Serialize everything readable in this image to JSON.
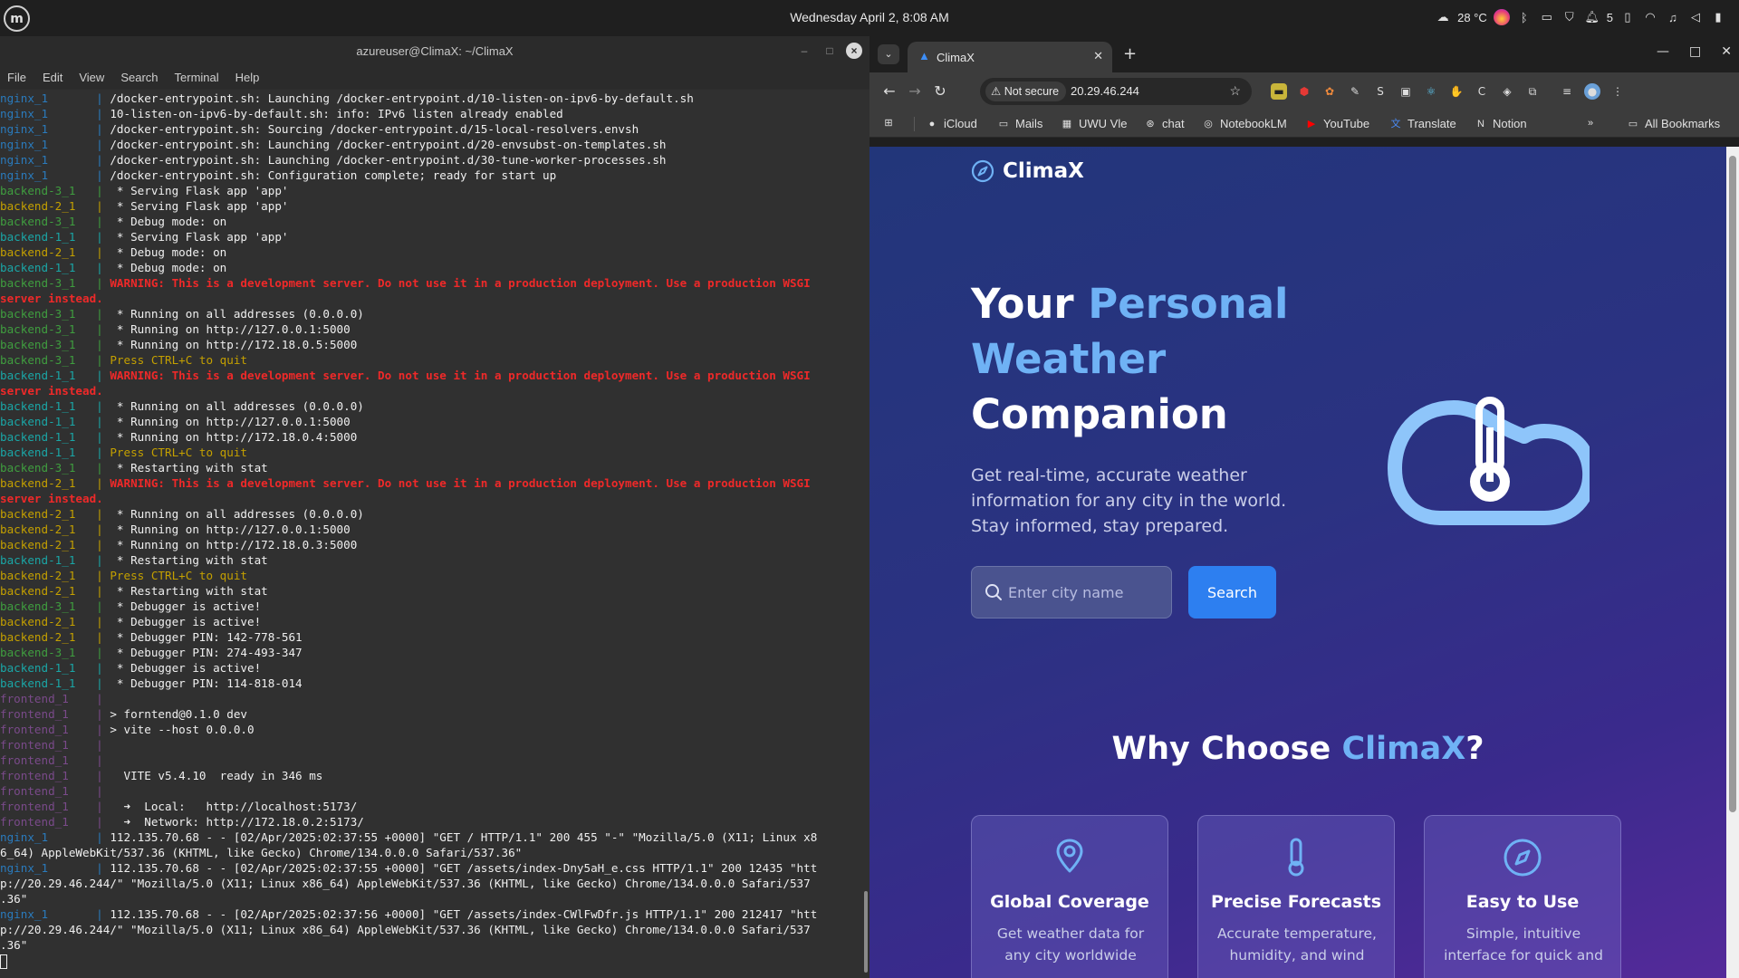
{
  "system": {
    "clock": "Wednesday April 2, 8:08 AM",
    "temperature": "28 °C",
    "notification_count": "5"
  },
  "terminal": {
    "title": "azureuser@ClimaX: ~/ClimaX",
    "menu": [
      "File",
      "Edit",
      "View",
      "Search",
      "Terminal",
      "Help"
    ],
    "lines": [
      {
        "src": "nginx_1",
        "c": "nginx",
        "text": "/docker-entrypoint.sh: Launching /docker-entrypoint.d/10-listen-on-ipv6-by-default.sh"
      },
      {
        "src": "nginx_1",
        "c": "nginx",
        "text": "10-listen-on-ipv6-by-default.sh: info: IPv6 listen already enabled"
      },
      {
        "src": "nginx_1",
        "c": "nginx",
        "text": "/docker-entrypoint.sh: Sourcing /docker-entrypoint.d/15-local-resolvers.envsh"
      },
      {
        "src": "nginx_1",
        "c": "nginx",
        "text": "/docker-entrypoint.sh: Launching /docker-entrypoint.d/20-envsubst-on-templates.sh"
      },
      {
        "src": "nginx_1",
        "c": "nginx",
        "text": "/docker-entrypoint.sh: Launching /docker-entrypoint.d/30-tune-worker-processes.sh"
      },
      {
        "src": "nginx_1",
        "c": "nginx",
        "text": "/docker-entrypoint.sh: Configuration complete; ready for start up"
      },
      {
        "src": "backend-3_1",
        "c": "b3",
        "text": " * Serving Flask app 'app'"
      },
      {
        "src": "backend-2_1",
        "c": "b2",
        "text": " * Serving Flask app 'app'"
      },
      {
        "src": "backend-3_1",
        "c": "b3",
        "text": " * Debug mode: on"
      },
      {
        "src": "backend-1_1",
        "c": "b1",
        "text": " * Serving Flask app 'app'"
      },
      {
        "src": "backend-2_1",
        "c": "b2",
        "text": " * Debug mode: on"
      },
      {
        "src": "backend-1_1",
        "c": "b1",
        "text": " * Debug mode: on"
      },
      {
        "src": "backend-3_1",
        "c": "b3",
        "text": "WARNING: This is a development server. Do not use it in a production deployment. Use a production WSGI",
        "tc": "warn"
      },
      {
        "src": "",
        "c": "",
        "text": "server instead.",
        "tc": "warn",
        "nopipe": true
      },
      {
        "src": "backend-3_1",
        "c": "b3",
        "text": " * Running on all addresses (0.0.0.0)"
      },
      {
        "src": "backend-3_1",
        "c": "b3",
        "text": " * Running on http://127.0.0.1:5000"
      },
      {
        "src": "backend-3_1",
        "c": "b3",
        "text": " * Running on http://172.18.0.5:5000"
      },
      {
        "src": "backend-3_1",
        "c": "b3",
        "text": "Press CTRL+C to quit",
        "tc": "yel"
      },
      {
        "src": "backend-1_1",
        "c": "b1",
        "text": "WARNING: This is a development server. Do not use it in a production deployment. Use a production WSGI",
        "tc": "warn"
      },
      {
        "src": "",
        "c": "",
        "text": "server instead.",
        "tc": "warn",
        "nopipe": true
      },
      {
        "src": "backend-1_1",
        "c": "b1",
        "text": " * Running on all addresses (0.0.0.0)"
      },
      {
        "src": "backend-1_1",
        "c": "b1",
        "text": " * Running on http://127.0.0.1:5000"
      },
      {
        "src": "backend-1_1",
        "c": "b1",
        "text": " * Running on http://172.18.0.4:5000"
      },
      {
        "src": "backend-1_1",
        "c": "b1",
        "text": "Press CTRL+C to quit",
        "tc": "yel"
      },
      {
        "src": "backend-3_1",
        "c": "b3",
        "text": " * Restarting with stat"
      },
      {
        "src": "backend-2_1",
        "c": "b2",
        "text": "WARNING: This is a development server. Do not use it in a production deployment. Use a production WSGI",
        "tc": "warn"
      },
      {
        "src": "",
        "c": "",
        "text": "server instead.",
        "tc": "warn",
        "nopipe": true
      },
      {
        "src": "backend-2_1",
        "c": "b2",
        "text": " * Running on all addresses (0.0.0.0)"
      },
      {
        "src": "backend-2_1",
        "c": "b2",
        "text": " * Running on http://127.0.0.1:5000"
      },
      {
        "src": "backend-2_1",
        "c": "b2",
        "text": " * Running on http://172.18.0.3:5000"
      },
      {
        "src": "backend-1_1",
        "c": "b1",
        "text": " * Restarting with stat"
      },
      {
        "src": "backend-2_1",
        "c": "b2",
        "text": "Press CTRL+C to quit",
        "tc": "yel"
      },
      {
        "src": "backend-2_1",
        "c": "b2",
        "text": " * Restarting with stat"
      },
      {
        "src": "backend-3_1",
        "c": "b3",
        "text": " * Debugger is active!"
      },
      {
        "src": "backend-2_1",
        "c": "b2",
        "text": " * Debugger is active!"
      },
      {
        "src": "backend-2_1",
        "c": "b2",
        "text": " * Debugger PIN: 142-778-561"
      },
      {
        "src": "backend-3_1",
        "c": "b3",
        "text": " * Debugger PIN: 274-493-347"
      },
      {
        "src": "backend-1_1",
        "c": "b1",
        "text": " * Debugger is active!"
      },
      {
        "src": "backend-1_1",
        "c": "b1",
        "text": " * Debugger PIN: 114-818-014"
      },
      {
        "src": "frontend_1",
        "c": "fe",
        "text": ""
      },
      {
        "src": "frontend_1",
        "c": "fe",
        "text": "> forntend@0.1.0 dev"
      },
      {
        "src": "frontend_1",
        "c": "fe",
        "text": "> vite --host 0.0.0.0"
      },
      {
        "src": "frontend_1",
        "c": "fe",
        "text": ""
      },
      {
        "src": "frontend_1",
        "c": "fe",
        "text": ""
      },
      {
        "src": "frontend_1",
        "c": "fe",
        "text": "  VITE v5.4.10  ready in 346 ms"
      },
      {
        "src": "frontend_1",
        "c": "fe",
        "text": ""
      },
      {
        "src": "frontend_1",
        "c": "fe",
        "text": "  ➜  Local:   http://localhost:5173/"
      },
      {
        "src": "frontend_1",
        "c": "fe",
        "text": "  ➜  Network: http://172.18.0.2:5173/"
      },
      {
        "src": "nginx_1",
        "c": "nginx",
        "text": "112.135.70.68 - - [02/Apr/2025:02:37:55 +0000] \"GET / HTTP/1.1\" 200 455 \"-\" \"Mozilla/5.0 (X11; Linux x8"
      },
      {
        "src": "",
        "c": "",
        "text": "6_64) AppleWebKit/537.36 (KHTML, like Gecko) Chrome/134.0.0.0 Safari/537.36\"",
        "nopipe": true
      },
      {
        "src": "nginx_1",
        "c": "nginx",
        "text": "112.135.70.68 - - [02/Apr/2025:02:37:55 +0000] \"GET /assets/index-Dny5aH_e.css HTTP/1.1\" 200 12435 \"htt"
      },
      {
        "src": "",
        "c": "",
        "text": "p://20.29.46.244/\" \"Mozilla/5.0 (X11; Linux x86_64) AppleWebKit/537.36 (KHTML, like Gecko) Chrome/134.0.0.0 Safari/537",
        "nopipe": true
      },
      {
        "src": "",
        "c": "",
        "text": ".36\"",
        "nopipe": true
      },
      {
        "src": "nginx_1",
        "c": "nginx",
        "text": "112.135.70.68 - - [02/Apr/2025:02:37:56 +0000] \"GET /assets/index-CWlFwDfr.js HTTP/1.1\" 200 212417 \"htt"
      },
      {
        "src": "",
        "c": "",
        "text": "p://20.29.46.244/\" \"Mozilla/5.0 (X11; Linux x86_64) AppleWebKit/537.36 (KHTML, like Gecko) Chrome/134.0.0.0 Safari/537",
        "nopipe": true
      },
      {
        "src": "",
        "c": "",
        "text": ".36\"",
        "nopipe": true
      }
    ]
  },
  "browser": {
    "tab_title": "ClimaX",
    "security_label": "Not secure",
    "url": "20.29.46.244",
    "bookmarks": [
      {
        "label": "iCloud",
        "icon": "apple-icon"
      },
      {
        "label": "Mails",
        "icon": "folder-icon"
      },
      {
        "label": "UWU Vle",
        "icon": "building-icon"
      },
      {
        "label": "chat",
        "icon": "chatgpt-icon"
      },
      {
        "label": "NotebookLM",
        "icon": "notebooklm-icon"
      },
      {
        "label": "YouTube",
        "icon": "youtube-icon"
      },
      {
        "label": "Translate",
        "icon": "translate-icon"
      },
      {
        "label": "Notion",
        "icon": "notion-icon"
      }
    ],
    "all_bookmarks": "All Bookmarks"
  },
  "site": {
    "brand": "ClimaX",
    "hero_title_1": "Your ",
    "hero_title_accent": "Personal Weather",
    "hero_title_2": "Companion",
    "hero_subtitle": "Get real-time, accurate weather information for any city in the world. Stay informed, stay prepared.",
    "search_placeholder": "Enter city name",
    "search_button": "Search",
    "why_prefix": "Why Choose ",
    "why_accent": "ClimaX",
    "why_suffix": "?",
    "features": [
      {
        "title": "Global Coverage",
        "desc": "Get weather data for any city worldwide",
        "icon": "map-pin-icon"
      },
      {
        "title": "Precise Forecasts",
        "desc": "Accurate temperature, humidity, and wind",
        "icon": "thermometer-icon"
      },
      {
        "title": "Easy to Use",
        "desc": "Simple, intuitive interface for quick and",
        "icon": "compass-icon"
      }
    ],
    "colors": {
      "accent": "#6fb2f5",
      "button": "#2d7ff0"
    }
  }
}
